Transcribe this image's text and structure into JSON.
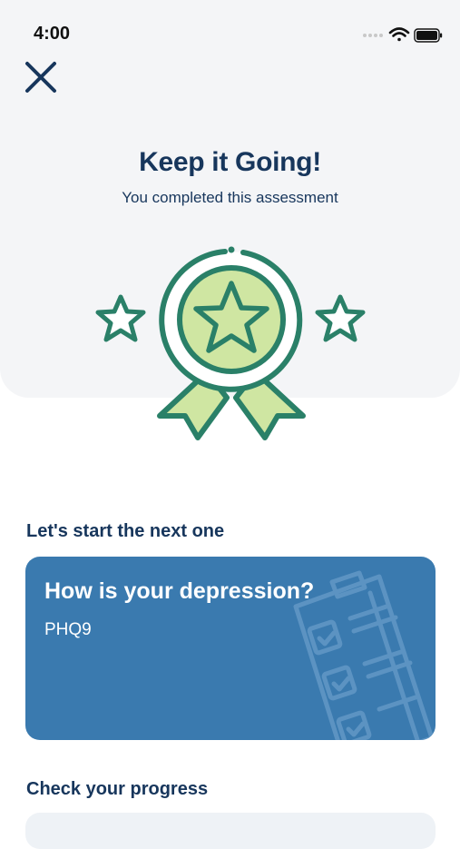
{
  "status_bar": {
    "time": "4:00"
  },
  "header": {
    "title": "Keep it Going!",
    "subtitle": "You completed this assessment"
  },
  "next_section": {
    "heading": "Let's start the next one",
    "card": {
      "title": "How is your depression?",
      "code": "PHQ9"
    }
  },
  "progress_section": {
    "heading": "Check your progress"
  },
  "colors": {
    "primary_text": "#17365c",
    "badge_green": "#2a8068",
    "badge_fill": "#cfe6a2",
    "card_blue": "#3a7aaf",
    "panel_bg": "#f4f5f7"
  },
  "icons": {
    "close": "close-icon",
    "badge": "award-badge-icon",
    "star": "star-icon",
    "wifi": "wifi-icon",
    "battery": "battery-icon",
    "checklist": "checklist-icon"
  }
}
